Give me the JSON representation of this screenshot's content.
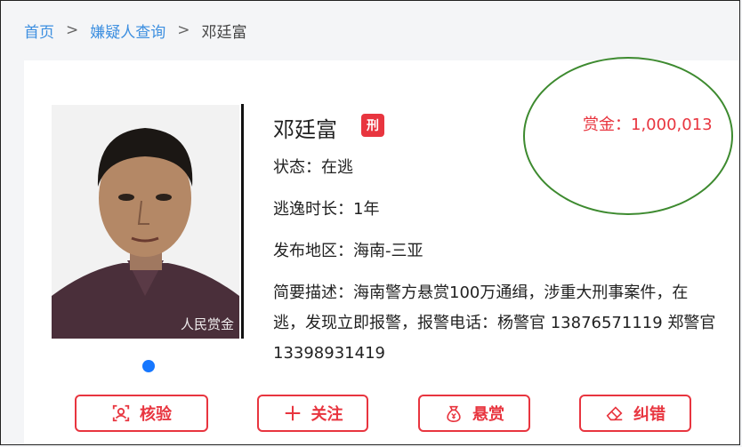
{
  "breadcrumb": {
    "home": "首页",
    "sep1": ">",
    "suspect_query": "嫌疑人查询",
    "sep2": ">",
    "current": "邓廷富"
  },
  "profile": {
    "name": "邓廷富",
    "badge": "刑",
    "status": "状态：在逃",
    "duration": "逃逸时长：1年",
    "region": "发布地区：海南-三亚",
    "description": "简要描述：海南警方悬赏100万通缉，涉重大刑事案件，在逃，发现立即报警，报警电话：杨警官 13876571119 郑警官 13398931419",
    "reward": "赏金：1,000,013",
    "photo_watermark": "人民赏金"
  },
  "actions": {
    "verify": "核验",
    "follow": "关注",
    "bounty": "悬赏",
    "correct": "纠错"
  },
  "colors": {
    "accent_red": "#e8353f",
    "link_blue": "#3d8fe0",
    "carousel_dot": "#1677ff",
    "annotation_green": "#3d8a2f"
  }
}
